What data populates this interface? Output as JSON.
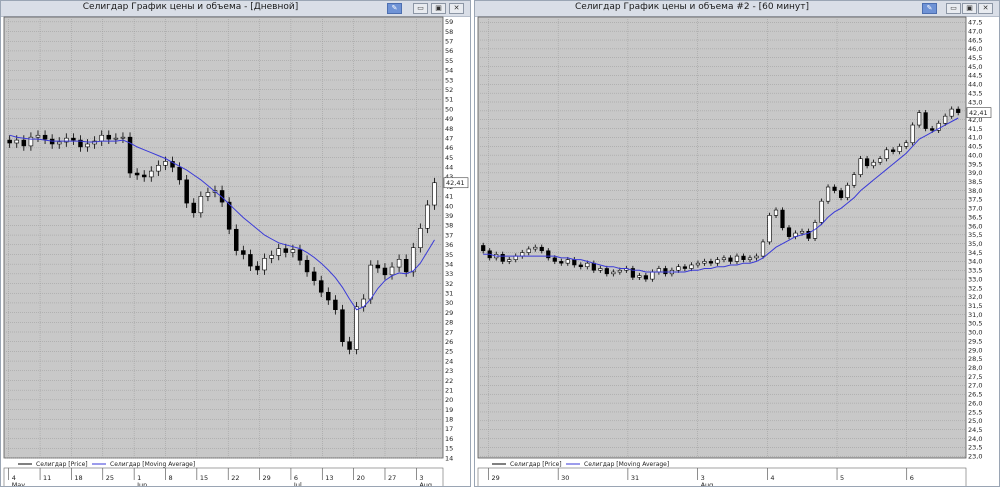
{
  "colors": {
    "plot_bg": "#c8c8c8",
    "grid": "#9a9a9a",
    "candle_up": "#ffffff",
    "candle_down": "#000000",
    "ma_line": "#3a3ad8",
    "title_bg": "#d9dee7",
    "pin_button": "#6f93d6"
  },
  "window_buttons": {
    "pin_icon": "✎",
    "minimize_icon": "▭",
    "restore_icon": "▣",
    "close_icon": "✕"
  },
  "windows": [
    {
      "title": "Селигдар График цены и объема - [Дневной]",
      "legend": [
        "Селигдар [Price]",
        "Селигдар [Moving Average]"
      ],
      "price_badge": "42,41",
      "chart_data": {
        "type": "candlestick",
        "ylim": [
          14,
          59.5
        ],
        "yticks": [
          14,
          15,
          16,
          17,
          18,
          19,
          20,
          21,
          22,
          23,
          24,
          25,
          26,
          27,
          28,
          29,
          30,
          31,
          32,
          33,
          34,
          35,
          36,
          37,
          38,
          39,
          40,
          41,
          42,
          43,
          44,
          45,
          46,
          47,
          48,
          49,
          50,
          51,
          52,
          53,
          54,
          55,
          56,
          57,
          58,
          59
        ],
        "x_tick_labels": [
          "4",
          "11",
          "18",
          "25",
          "1",
          "8",
          "15",
          "22",
          "29",
          "6",
          "13",
          "20",
          "27",
          "3"
        ],
        "x_month_labels": [
          "May",
          "",
          "",
          "",
          "Jun",
          "",
          "",
          "",
          "",
          "Jul",
          "",
          "",
          "",
          "Aug"
        ],
        "close": [
          46.5,
          46.8,
          46.2,
          47.1,
          47.3,
          46.9,
          46.4,
          46.6,
          47.0,
          46.8,
          46.1,
          46.4,
          46.7,
          47.3,
          46.9,
          47.0,
          47.1,
          43.4,
          43.2,
          43.0,
          43.6,
          44.2,
          44.6,
          44.0,
          42.7,
          40.3,
          39.3,
          41.0,
          41.4,
          41.6,
          40.4,
          37.6,
          35.4,
          35.0,
          33.8,
          33.4,
          34.6,
          34.9,
          35.6,
          35.2,
          35.5,
          34.4,
          33.2,
          32.3,
          31.1,
          30.3,
          29.3,
          26.0,
          25.2,
          29.6,
          30.4,
          33.9,
          33.6,
          32.9,
          33.7,
          34.5,
          33.2,
          35.7,
          37.7,
          40.1,
          42.4
        ],
        "ma": [
          47.3,
          47.1,
          47.0,
          46.9,
          46.9,
          46.8,
          46.7,
          46.7,
          46.7,
          46.7,
          46.7,
          46.6,
          46.6,
          46.7,
          46.7,
          46.7,
          46.8,
          46.5,
          46.1,
          45.8,
          45.5,
          45.2,
          44.9,
          44.5,
          44.1,
          43.7,
          43.2,
          42.7,
          42.1,
          41.5,
          40.9,
          40.2,
          39.5,
          38.8,
          38.2,
          37.6,
          37.0,
          36.6,
          36.2,
          36.0,
          35.8,
          35.6,
          35.2,
          34.7,
          34.1,
          33.4,
          32.6,
          31.6,
          30.4,
          29.3,
          29.6,
          30.4,
          31.5,
          32.3,
          32.8,
          33.1,
          33.0,
          33.3,
          34.1,
          35.3,
          36.5
        ]
      }
    },
    {
      "title": "Селигдар График цены и объема #2 - [60 минут]",
      "legend": [
        "Селигдар [Price]",
        "Селигдар [Moving Average]"
      ],
      "price_badge": "42,41",
      "chart_data": {
        "type": "candlestick",
        "ylim": [
          22.9,
          47.8
        ],
        "yticks": [
          23.0,
          23.5,
          24.0,
          24.5,
          25.0,
          25.5,
          26.0,
          26.5,
          27.0,
          27.5,
          28.0,
          28.5,
          29.0,
          29.5,
          30.0,
          30.5,
          31.0,
          31.5,
          32.0,
          32.5,
          33.0,
          33.5,
          34.0,
          34.5,
          35.0,
          35.5,
          36.0,
          36.5,
          37.0,
          37.5,
          38.0,
          38.5,
          39.0,
          39.5,
          40.0,
          40.5,
          41.0,
          41.5,
          42.0,
          42.5,
          43.0,
          43.5,
          44.0,
          44.5,
          45.0,
          45.5,
          46.0,
          46.5,
          47.0,
          47.5
        ],
        "tick_labels": [
          "23,0",
          "23,5",
          "24,0",
          "24,5",
          "25,0",
          "25,5",
          "26,0",
          "26,5",
          "27,0",
          "27,5",
          "28,0",
          "28,5",
          "29,0",
          "29,5",
          "30,0",
          "30,5",
          "31,0",
          "31,5",
          "32,0",
          "32,5",
          "33,0",
          "33,5",
          "34,0",
          "34,5",
          "35,0",
          "35,5",
          "36,0",
          "36,5",
          "37,0",
          "37,5",
          "38,0",
          "38,5",
          "39,0",
          "39,5",
          "40,0",
          "40,5",
          "41,0",
          "41,5",
          "42,0",
          "42,5",
          "43,0",
          "43,5",
          "44,0",
          "44,5",
          "45,0",
          "45,5",
          "46,0",
          "46,5",
          "47,0",
          "47,5"
        ],
        "x_tick_labels": [
          "29",
          "30",
          "31",
          "3",
          "4",
          "5",
          "6"
        ],
        "x_month_labels": [
          "",
          "",
          "",
          "Aug",
          "",
          "",
          ""
        ],
        "close": [
          34.6,
          34.2,
          34.4,
          34.0,
          34.1,
          34.3,
          34.5,
          34.7,
          34.8,
          34.6,
          34.2,
          34.0,
          33.9,
          34.1,
          33.8,
          33.7,
          33.9,
          33.5,
          33.6,
          33.3,
          33.4,
          33.5,
          33.6,
          33.1,
          33.2,
          33.0,
          33.4,
          33.6,
          33.3,
          33.5,
          33.7,
          33.6,
          33.8,
          33.9,
          34.0,
          33.9,
          34.1,
          34.2,
          34.0,
          34.3,
          34.1,
          34.2,
          34.3,
          35.1,
          36.6,
          36.9,
          35.9,
          35.4,
          35.6,
          35.7,
          35.3,
          36.2,
          37.4,
          38.2,
          38.0,
          37.6,
          38.3,
          38.9,
          39.8,
          39.4,
          39.6,
          39.8,
          40.3,
          40.2,
          40.5,
          40.7,
          41.7,
          42.4,
          41.5,
          41.4,
          41.8,
          42.2,
          42.6,
          42.4
        ],
        "ma": [
          34.4,
          34.4,
          34.3,
          34.3,
          34.3,
          34.3,
          34.3,
          34.3,
          34.3,
          34.3,
          34.3,
          34.3,
          34.2,
          34.2,
          34.1,
          34.1,
          34.0,
          33.9,
          33.8,
          33.7,
          33.7,
          33.6,
          33.6,
          33.5,
          33.5,
          33.4,
          33.4,
          33.4,
          33.4,
          33.4,
          33.4,
          33.4,
          33.5,
          33.5,
          33.6,
          33.6,
          33.7,
          33.7,
          33.8,
          33.8,
          33.9,
          33.9,
          34.0,
          34.2,
          34.5,
          34.8,
          35.0,
          35.2,
          35.4,
          35.5,
          35.6,
          35.8,
          36.1,
          36.5,
          36.8,
          37.0,
          37.3,
          37.6,
          38.0,
          38.3,
          38.6,
          38.9,
          39.2,
          39.5,
          39.8,
          40.1,
          40.5,
          40.9,
          41.1,
          41.3,
          41.5,
          41.7,
          41.9,
          42.1
        ]
      }
    }
  ]
}
